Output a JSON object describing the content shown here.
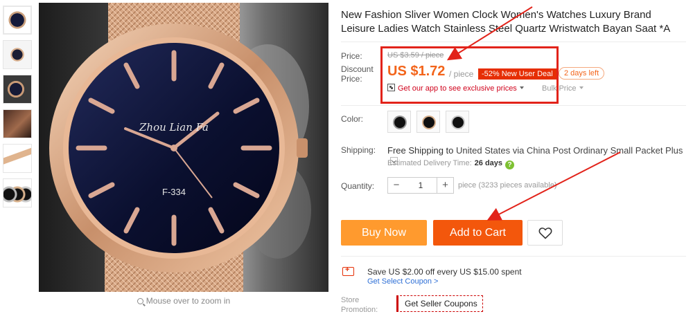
{
  "gallery": {
    "thumbnails": [
      "thumbnail-1",
      "thumbnail-2",
      "thumbnail-3",
      "thumbnail-4",
      "thumbnail-5",
      "thumbnail-6"
    ],
    "watch_brand_text": "Zhou Lian Fa",
    "watch_model_text": "F-334",
    "zoom_hint": "Mouse over to zoom in"
  },
  "product": {
    "title": "New Fashion Sliver Women Clock Women's Watches Luxury Brand Leisure Ladies Watch Stainless Steel Quartz Wristwatch Bayan Saat *A"
  },
  "pricing": {
    "price_label": "Price:",
    "discount_label": "Discount Price:",
    "original_price": "US $3.59 / piece",
    "discount_price": "US $1.72",
    "per_unit": "/ piece",
    "deal_badge": "-52% New User Deal",
    "days_left": "2 days left",
    "app_link": "Get our app to see exclusive prices",
    "bulk_price": "Bulk Price"
  },
  "options": {
    "color_label": "Color:",
    "colors": [
      "silver-mesh",
      "rose-gold-mesh",
      "silver-steel"
    ],
    "shipping_label": "Shipping:",
    "shipping_free": "Free Shipping to",
    "shipping_dest": "United States via China Post Ordinary Small Packet Plus",
    "est_label": "Estimated Delivery Time:",
    "est_days": "26 days",
    "help_icon": "?",
    "quantity_label": "Quantity:",
    "quantity_value": "1",
    "minus": "−",
    "plus": "+",
    "pieces_available": "piece (3233 pieces available)"
  },
  "actions": {
    "buy_now": "Buy Now",
    "add_to_cart": "Add to Cart",
    "wishlist_icon": "heart-icon"
  },
  "coupons": {
    "coupon_text": "Save US $2.00 off every US $15.00 spent",
    "coupon_link": "Get Select Coupon >",
    "store_promo_label": "Store Promotion:",
    "store_promo_select": "Get Seller Coupons"
  },
  "colors": {
    "accent_orange": "#f3570c",
    "buy_now_orange": "#ff9a2e",
    "price_orange": "#f3641a",
    "annotation_red": "#e2231a"
  }
}
